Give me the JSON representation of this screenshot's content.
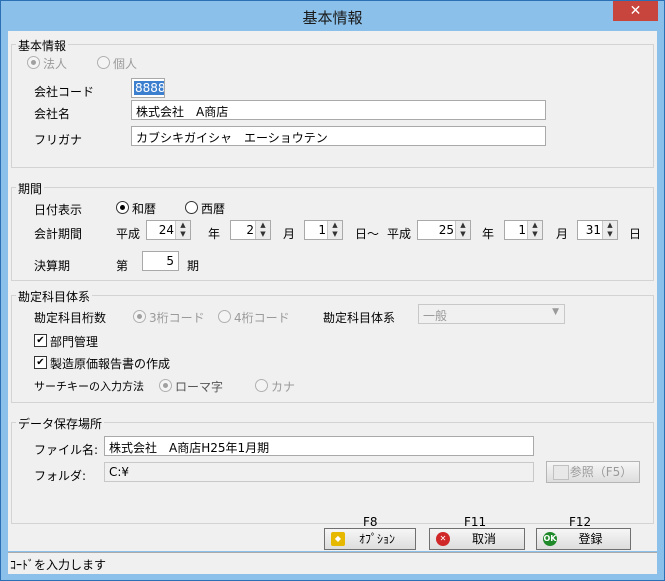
{
  "window": {
    "title": "基本情報",
    "close": "✕"
  },
  "basic": {
    "group_label": "基本情報",
    "radio_corp": "法人",
    "radio_indiv": "個人",
    "code_label": "会社コード",
    "code_value": "8888",
    "name_label": "会社名",
    "name_value": "株式会社　A商店",
    "kana_label": "フリガナ",
    "kana_value": "カブシキガイシャ　エーショウテン"
  },
  "period": {
    "group_label": "期間",
    "date_display_label": "日付表示",
    "radio_wareki": "和暦",
    "radio_seireki": "西暦",
    "term_label": "会計期間",
    "era1": "平成",
    "year1": "24",
    "year_unit1": "年",
    "month1": "2",
    "month_unit1": "月",
    "day1": "1",
    "day_unit_tilde": "日～",
    "era2": "平成",
    "year2": "25",
    "year_unit2": "年",
    "month2": "1",
    "month_unit2": "月",
    "day2": "31",
    "day_unit2": "日",
    "settle_label": "決算期",
    "settle_prefix": "第",
    "settle_value": "5",
    "settle_suffix": "期"
  },
  "accounts": {
    "group_label": "勘定科目体系",
    "digits_label": "勘定科目桁数",
    "radio_3": "3桁コード",
    "radio_4": "4桁コード",
    "system_label": "勘定科目体系",
    "system_value": "一般",
    "chk_dept": "部門管理",
    "chk_cost": "製造原価報告書の作成",
    "search_label": "サーチキーの入力方法",
    "radio_roma": "ローマ字",
    "radio_kana": "カナ"
  },
  "storage": {
    "group_label": "データ保存場所",
    "file_label": "ファイル名:",
    "file_value": "株式会社　A商店H25年1月期",
    "folder_label": "フォルダ:",
    "folder_value": "C:¥",
    "browse": "参照（F5）"
  },
  "buttons": {
    "option_key": "F8",
    "option_label": "ｵﾌﾟｼｮﾝ",
    "cancel_key": "F11",
    "cancel_label": "取消",
    "register_key": "F12",
    "register_label": "登録"
  },
  "status": {
    "text": "ｺｰﾄﾞを入力します"
  },
  "colors": {
    "title_bar": "#8ac0ea",
    "close": "#c7453c",
    "selected_code_bg": "#3d7fcf",
    "cancel_icon": "#d02828",
    "ok_icon": "#1f8a2a"
  }
}
